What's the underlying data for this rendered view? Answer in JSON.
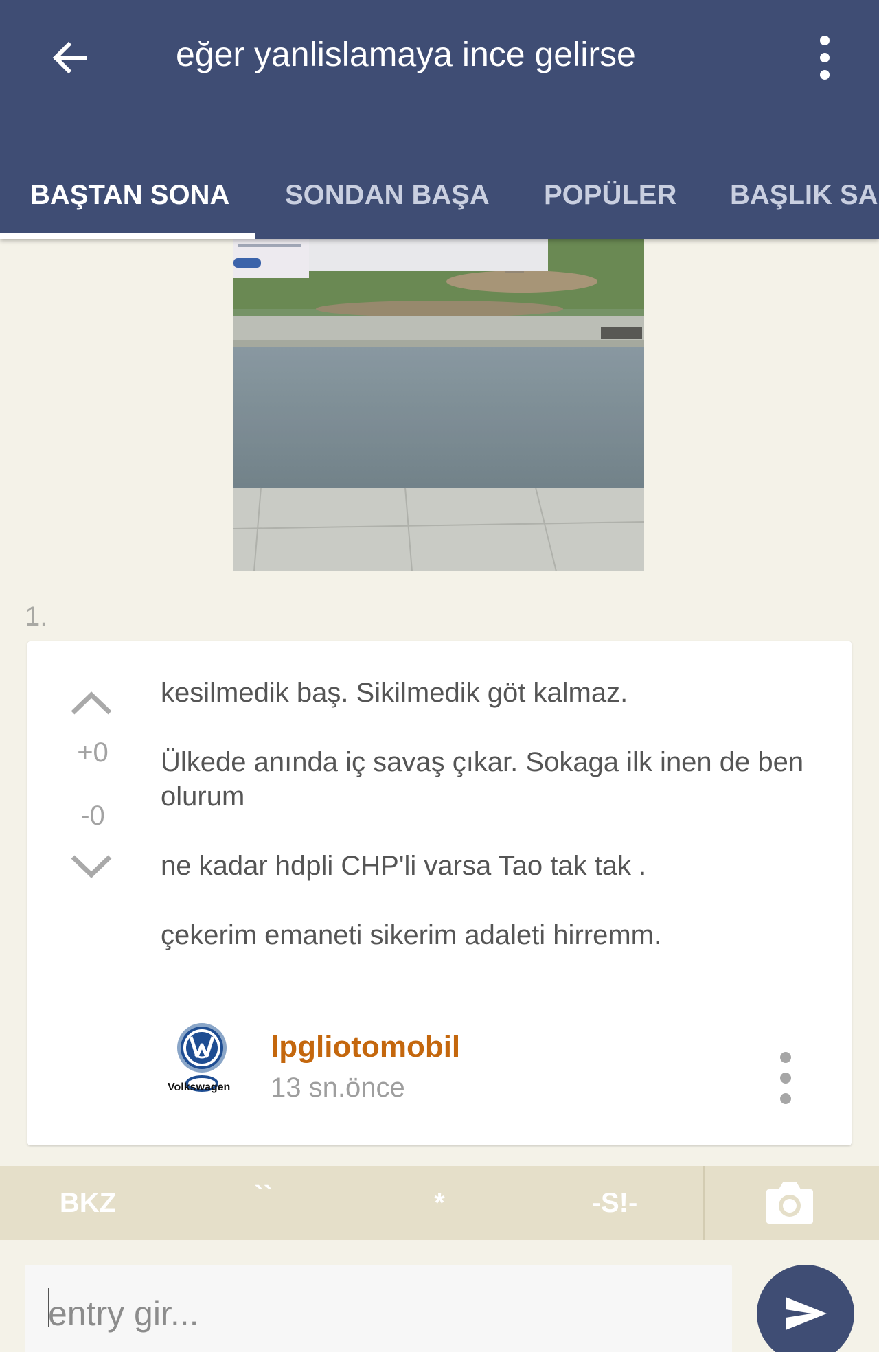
{
  "header": {
    "title": "eğer yanlislamaya ince gelirse",
    "back_icon": "arrow-left-icon",
    "menu_icon": "more-vertical-icon"
  },
  "tabs": [
    {
      "label": "BAŞTAN SONA",
      "active": true
    },
    {
      "label": "SONDAN BAŞA",
      "active": false
    },
    {
      "label": "POPÜLER",
      "active": false
    },
    {
      "label": "BAŞLIK SAN",
      "active": false
    }
  ],
  "entry": {
    "number": "1.",
    "votes": {
      "up": "+0",
      "down": "-0"
    },
    "paragraphs": [
      "kesilmedik baş. Sikilmedik göt kalmaz.",
      "Ülkede anında iç savaş çıkar. Sokaga ilk inen de ben olurum",
      "ne kadar hdpli CHP'li varsa Tao tak tak .",
      "çekerim emaneti sikerim adaleti hirremm."
    ],
    "author": "lpgliotomobil",
    "time": "13 sn.önce",
    "avatar_text": "Volkswagen"
  },
  "toolbar": {
    "bkz": "BKZ",
    "backtick": "``",
    "star": "*",
    "spoiler": "-S!-",
    "camera_icon": "camera-icon"
  },
  "compose": {
    "placeholder": "entry gir...",
    "value": "",
    "send_icon": "send-icon"
  },
  "colors": {
    "primary": "#3f4d74",
    "author": "#c4670d",
    "background": "#f4f2e8",
    "toolbar": "#e5dfc9"
  }
}
